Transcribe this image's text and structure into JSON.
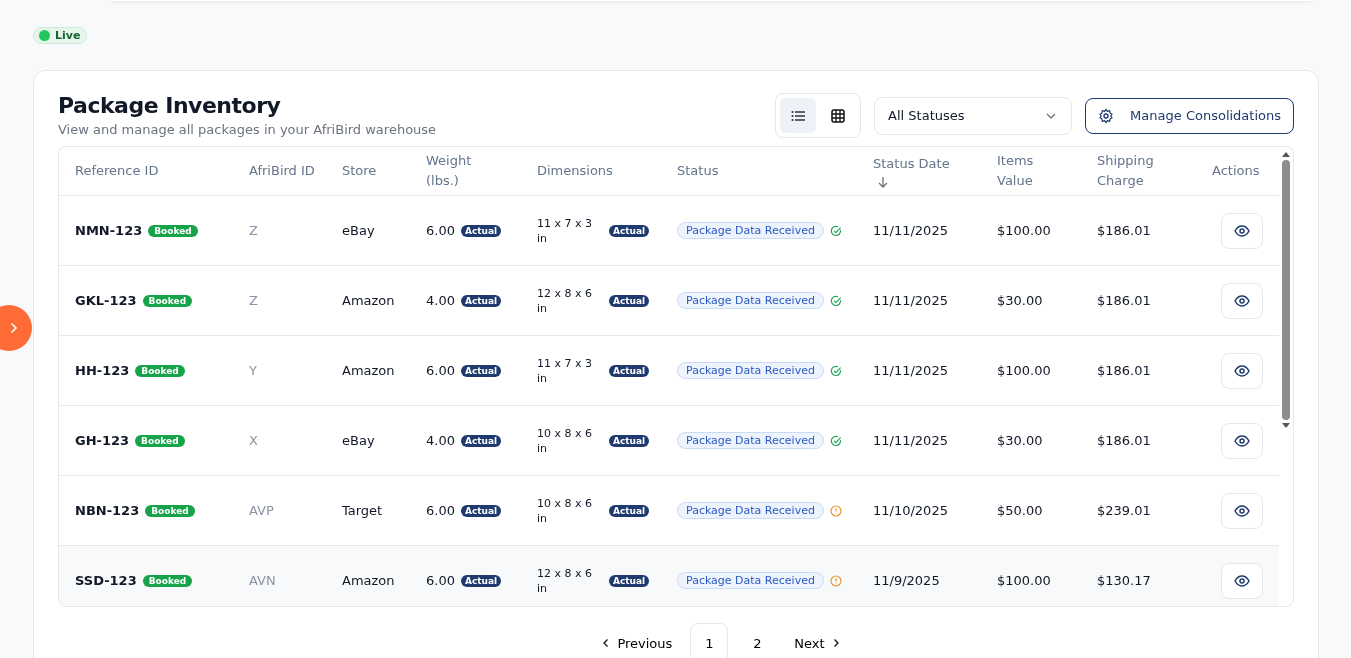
{
  "live_badge": {
    "label": "Live",
    "on": true
  },
  "panel": {
    "title": "Package Inventory",
    "subtitle": "View and manage all packages in your AfriBird warehouse"
  },
  "view_toggle": [
    {
      "kind": "list",
      "selected": true
    },
    {
      "kind": "grid",
      "selected": false
    }
  ],
  "status_filter": {
    "value": "All Statuses"
  },
  "manage_button": {
    "label": "Manage Consolidations"
  },
  "table": {
    "columns": [
      {
        "label": "Reference ID",
        "sorted": false
      },
      {
        "label": "AfriBird ID",
        "sorted": false
      },
      {
        "label": "Store",
        "sorted": false
      },
      {
        "label": "Weight (lbs.)",
        "sorted": false
      },
      {
        "label": "Dimensions",
        "sorted": false
      },
      {
        "label": "Status",
        "sorted": false
      },
      {
        "label": "Status Date",
        "sorted": true
      },
      {
        "label": "Items Value",
        "sorted": false
      },
      {
        "label": "Shipping Charge",
        "sorted": false
      },
      {
        "label": "Actions",
        "sorted": false
      }
    ],
    "rows": [
      {
        "ref": "NMN-123",
        "tag": "Booked",
        "afribird_id": "Z",
        "store": "eBay",
        "weight": "6.00",
        "weight_tag": "Actual",
        "dimensions": "11 x 7 x 3 in",
        "dim_tag": "Actual",
        "status": "Package Data Received",
        "kind": "check",
        "date": "11/11/2025",
        "value": "$100.00",
        "charge": "$186.01",
        "hovered": false
      },
      {
        "ref": "GKL-123",
        "tag": "Booked",
        "afribird_id": "Z",
        "store": "Amazon",
        "weight": "4.00",
        "weight_tag": "Actual",
        "dimensions": "12 x 8 x 6 in",
        "dim_tag": "Actual",
        "status": "Package Data Received",
        "kind": "check",
        "date": "11/11/2025",
        "value": "$30.00",
        "charge": "$186.01",
        "hovered": false
      },
      {
        "ref": "HH-123",
        "tag": "Booked",
        "afribird_id": "Y",
        "store": "Amazon",
        "weight": "6.00",
        "weight_tag": "Actual",
        "dimensions": "11 x 7 x 3 in",
        "dim_tag": "Actual",
        "status": "Package Data Received",
        "kind": "check",
        "date": "11/11/2025",
        "value": "$100.00",
        "charge": "$186.01",
        "hovered": false
      },
      {
        "ref": "GH-123",
        "tag": "Booked",
        "afribird_id": "X",
        "store": "eBay",
        "weight": "4.00",
        "weight_tag": "Actual",
        "dimensions": "10 x 8 x 6 in",
        "dim_tag": "Actual",
        "status": "Package Data Received",
        "kind": "check",
        "date": "11/11/2025",
        "value": "$30.00",
        "charge": "$186.01",
        "hovered": false
      },
      {
        "ref": "NBN-123",
        "tag": "Booked",
        "afribird_id": "AVP",
        "store": "Target",
        "weight": "6.00",
        "weight_tag": "Actual",
        "dimensions": "10 x 8 x 6 in",
        "dim_tag": "Actual",
        "status": "Package Data Received",
        "kind": "warning",
        "date": "11/10/2025",
        "value": "$50.00",
        "charge": "$239.01",
        "hovered": false
      },
      {
        "ref": "SSD-123",
        "tag": "Booked",
        "afribird_id": "AVN",
        "store": "Amazon",
        "weight": "6.00",
        "weight_tag": "Actual",
        "dimensions": "12 x 8 x 6 in",
        "dim_tag": "Actual",
        "status": "Package Data Received",
        "kind": "warning",
        "date": "11/9/2025",
        "value": "$100.00",
        "charge": "$130.17",
        "hovered": true
      }
    ]
  },
  "pagination": {
    "previous": "Previous",
    "pages": [
      {
        "label": "1",
        "selected": true
      },
      {
        "label": "2",
        "selected": false
      }
    ],
    "next": "Next"
  }
}
